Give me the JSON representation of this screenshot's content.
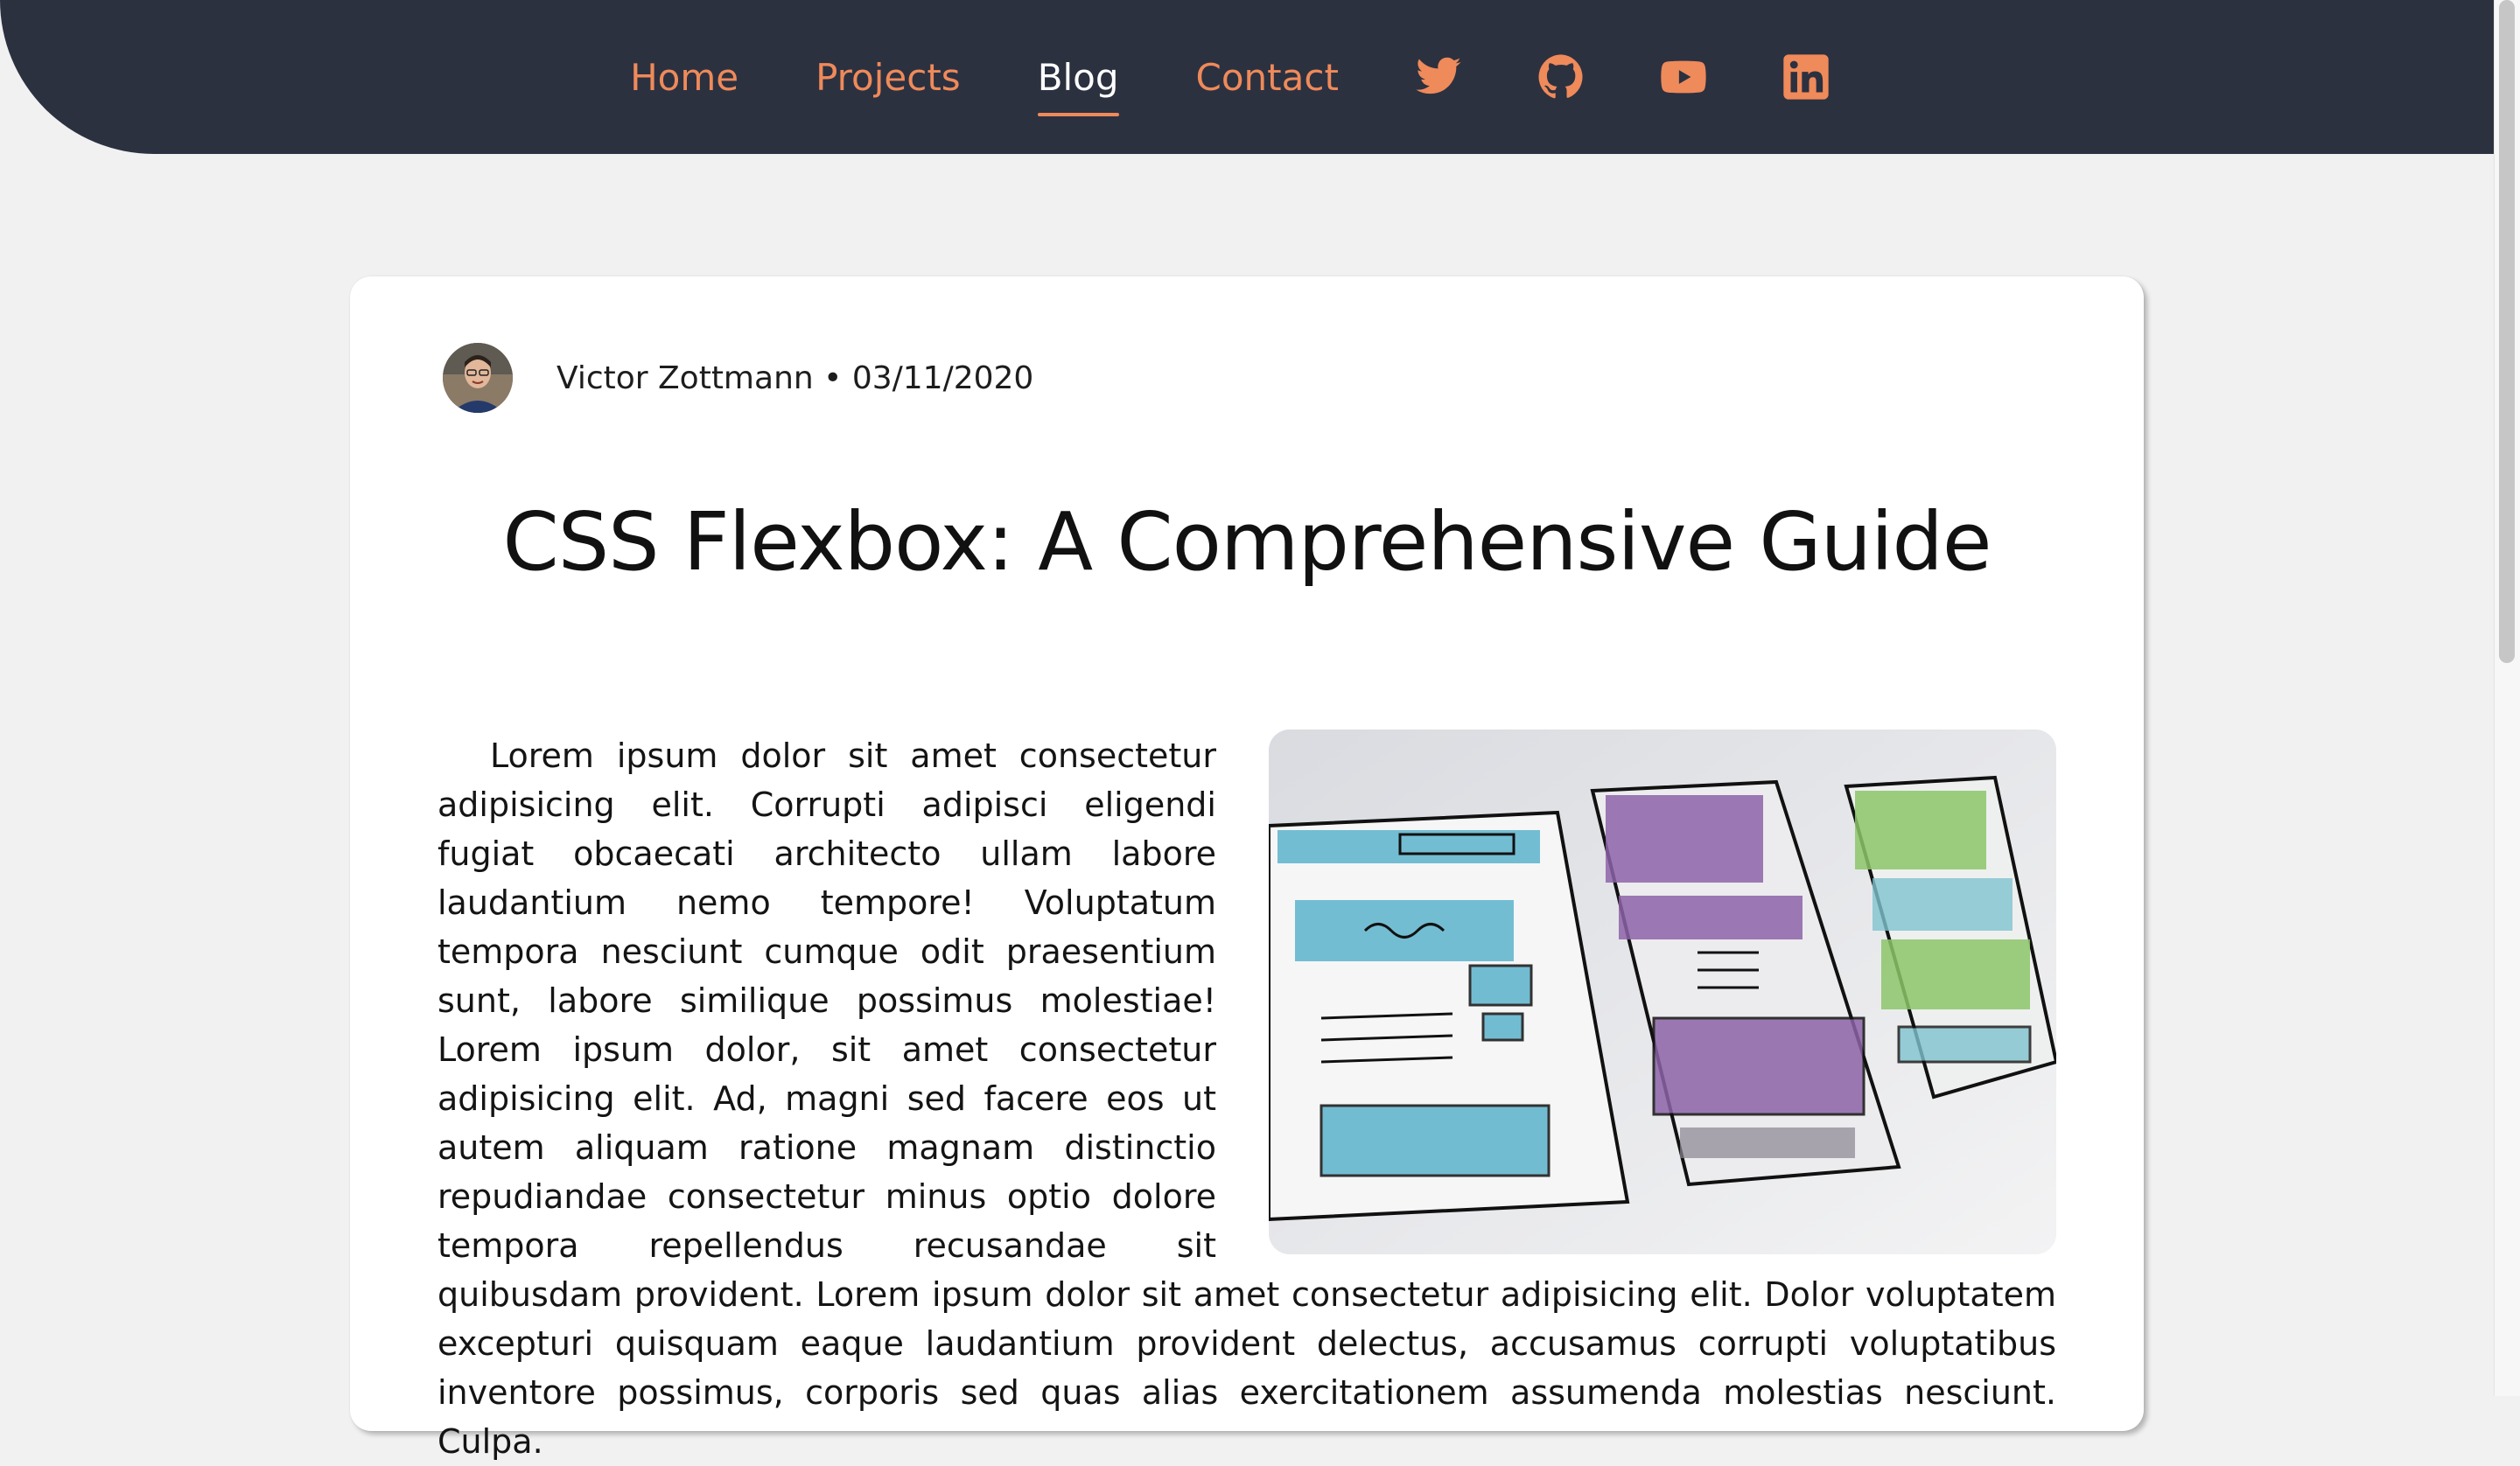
{
  "nav": {
    "links": [
      {
        "label": "Home",
        "active": false
      },
      {
        "label": "Projects",
        "active": false
      },
      {
        "label": "Blog",
        "active": true
      },
      {
        "label": "Contact",
        "active": false
      }
    ],
    "icons": [
      "twitter-icon",
      "github-icon",
      "youtube-icon",
      "linkedin-icon"
    ]
  },
  "post": {
    "author": "Victor Zottmann",
    "separator": "•",
    "date": "03/11/2020",
    "meta": "Victor Zottmann • 03/11/2020",
    "title": "CSS Flexbox: A Comprehensive Guide",
    "body": "Lorem ipsum dolor sit amet consectetur adipisicing elit. Corrupti adipisci eligendi fugiat obcaecati architecto ullam labore laudantium nemo tempore! Voluptatum tempora nesciunt cumque odit praesentium sunt, labore similique possimus molestiae! Lorem ipsum dolor, sit amet consectetur adipisicing elit. Ad, magni sed facere eos ut autem aliquam ratione magnam distinctio repudiandae consectetur minus optio dolore tempora repellendus recusandae sit quibusdam provident. Lorem ipsum dolor sit amet consectetur adipisicing elit. Dolor voluptatem excepturi quisquam eaque laudantium provident delectus, accusamus corrupti voluptatibus inventore possimus, corporis sed quas alias exercitationem assumenda molestias nesciunt. Culpa.",
    "image_icon": "wireframe-sketch-image",
    "avatar_icon": "author-avatar"
  },
  "colors": {
    "nav_bg": "#2c3140",
    "accent": "#ef8a5a",
    "page_bg": "#f1f1f1",
    "card_bg": "#ffffff"
  }
}
